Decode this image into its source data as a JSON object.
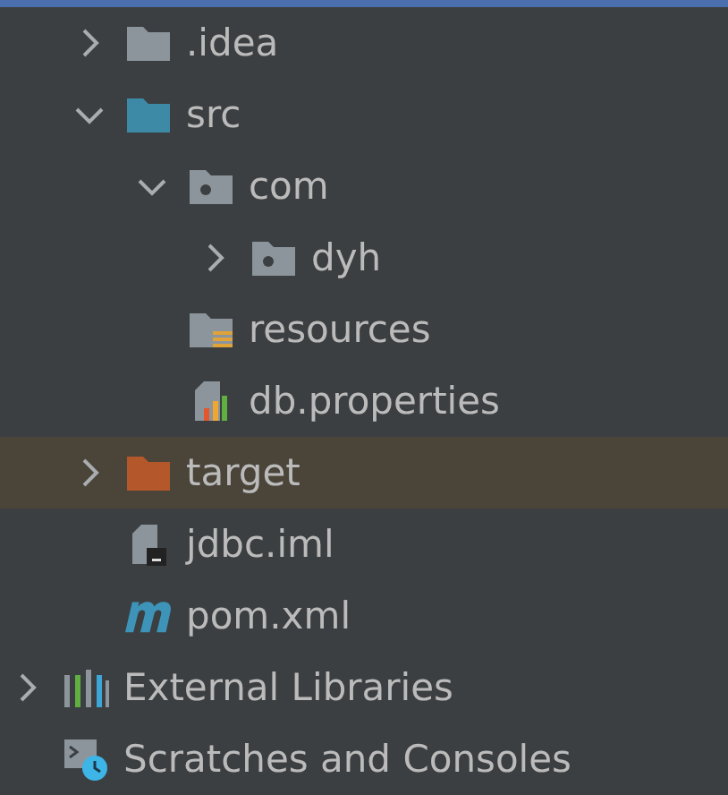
{
  "tree": [
    {
      "label": ".idea",
      "kind": "folder",
      "expanded": false,
      "selected": false
    },
    {
      "label": "src",
      "kind": "source-folder",
      "expanded": true,
      "selected": false,
      "children": [
        {
          "label": "com",
          "kind": "package",
          "expanded": true,
          "selected": false,
          "children": [
            {
              "label": "dyh",
              "kind": "package",
              "expanded": false,
              "selected": false
            }
          ]
        },
        {
          "label": "resources",
          "kind": "resources-folder",
          "selected": false
        },
        {
          "label": "db.properties",
          "kind": "properties-file",
          "selected": false
        }
      ]
    },
    {
      "label": "target",
      "kind": "excluded-folder",
      "expanded": false,
      "selected": true
    },
    {
      "label": "jdbc.iml",
      "kind": "module-file",
      "selected": false
    },
    {
      "label": "pom.xml",
      "kind": "maven-file",
      "selected": false
    }
  ],
  "roots": [
    {
      "label": "External Libraries",
      "kind": "libraries",
      "expanded": false,
      "selected": false
    },
    {
      "label": "Scratches and Consoles",
      "kind": "scratches",
      "selected": false
    }
  ]
}
